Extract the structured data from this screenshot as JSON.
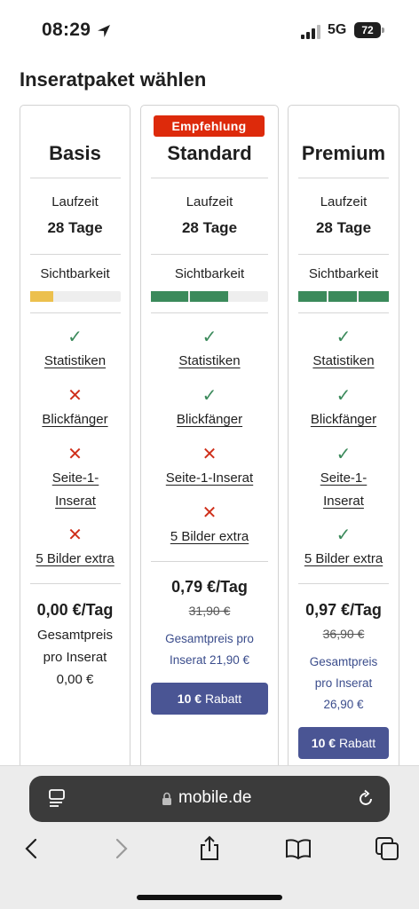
{
  "status": {
    "time": "08:29",
    "network": "5G",
    "battery": "72"
  },
  "page": {
    "title": "Inseratpaket wählen"
  },
  "plans": [
    {
      "name": "Basis",
      "duration_label": "Laufzeit",
      "duration_value": "28 Tage",
      "visibility_label": "Sichtbarkeit",
      "visibility_level": 0.25,
      "visibility_color": "#ecc04d",
      "features": [
        {
          "label": "Statistiken",
          "included": true
        },
        {
          "label": "Blickfänger",
          "included": false
        },
        {
          "label": "Seite-1-Inserat",
          "included": false
        },
        {
          "label": "5 Bilder extra",
          "included": false
        }
      ],
      "price": "0,00 €/Tag",
      "total_line1": "Gesamtpreis",
      "total_line2": "pro Inserat",
      "total_line3": "0,00 €"
    },
    {
      "name": "Standard",
      "badge": "Empfehlung",
      "duration_label": "Laufzeit",
      "duration_value": "28 Tage",
      "visibility_label": "Sichtbarkeit",
      "visibility_level": 0.66,
      "visibility_color": "#3b8a5b",
      "features": [
        {
          "label": "Statistiken",
          "included": true
        },
        {
          "label": "Blickfänger",
          "included": true
        },
        {
          "label": "Seite-1-Inserat",
          "included": false
        },
        {
          "label": "5 Bilder extra",
          "included": false
        }
      ],
      "price": "0,79 €/Tag",
      "old_price": "31,90 €",
      "total_line1": "Gesamtpreis pro",
      "total_line2": "Inserat 21,90 €",
      "discount_amount": "10 €",
      "discount_label": "Rabatt"
    },
    {
      "name": "Premium",
      "duration_label": "Laufzeit",
      "duration_value": "28 Tage",
      "visibility_label": "Sichtbarkeit",
      "visibility_level": 1.0,
      "visibility_color": "#3b8a5b",
      "features": [
        {
          "label": "Statistiken",
          "included": true
        },
        {
          "label": "Blickfänger",
          "included": true
        },
        {
          "label": "Seite-1-Inserat",
          "included": true
        },
        {
          "label": "5 Bilder extra",
          "included": true
        }
      ],
      "price": "0,97 €/Tag",
      "old_price": "36,90 €",
      "total_line1": "Gesamtpreis",
      "total_line2": "pro Inserat",
      "total_line3": "26,90 €",
      "discount_amount": "10 €",
      "discount_label": "Rabatt"
    }
  ],
  "browser": {
    "url": "mobile.de"
  },
  "colors": {
    "check": "#3b8a5b",
    "cross": "#cf2f1a",
    "badge": "#dd2a0b",
    "button": "#4a5594"
  }
}
